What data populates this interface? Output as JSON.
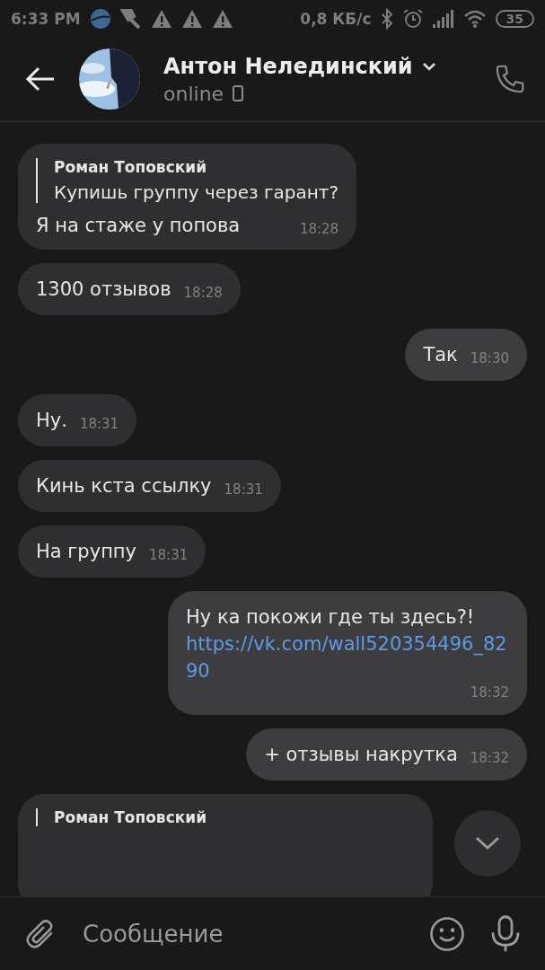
{
  "status_bar": {
    "time": "6:33 PM",
    "speed": "0,8 КБ/с",
    "battery": "35"
  },
  "header": {
    "name": "Антон Нелединский",
    "status": "online"
  },
  "messages": [
    {
      "kind": "reply",
      "outgoing": false,
      "quote_author": "Роман Топовский",
      "quote_text": "Купишь группу через гарант?",
      "text": "Я на стаже у попова",
      "time": "18:28"
    },
    {
      "kind": "text",
      "outgoing": false,
      "text": "1300 отзывов",
      "time": "18:28"
    },
    {
      "kind": "text",
      "outgoing": true,
      "text": "Так",
      "time": "18:30"
    },
    {
      "kind": "text",
      "outgoing": false,
      "text": "Ну.",
      "time": "18:31"
    },
    {
      "kind": "text",
      "outgoing": false,
      "text": "Кинь кста ссылку",
      "time": "18:31"
    },
    {
      "kind": "text",
      "outgoing": false,
      "text": "На группу",
      "time": "18:31"
    },
    {
      "kind": "link",
      "outgoing": true,
      "text": "Ну ка покожи где ты здесь?!",
      "link": "https://vk.com/wall520354496_8290",
      "time": "18:32"
    },
    {
      "kind": "text",
      "outgoing": true,
      "text": "+ отзывы накрутка",
      "time": "18:32"
    },
    {
      "kind": "reply",
      "outgoing": false,
      "quote_author": "Роман Топовский"
    }
  ],
  "composer": {
    "placeholder": "Сообщение"
  }
}
